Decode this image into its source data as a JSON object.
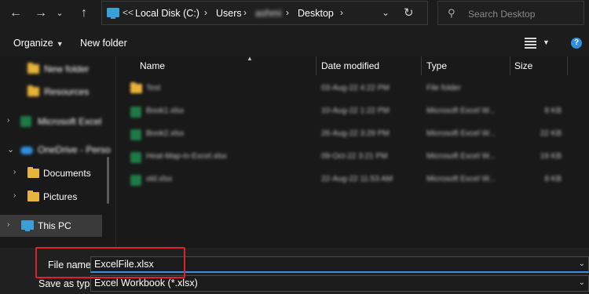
{
  "nav": {
    "back_icon": "arrow-left-icon",
    "forward_icon": "arrow-right-icon",
    "recent_icon": "chevron-down-icon",
    "up_icon": "arrow-up-icon"
  },
  "address": {
    "overflow": "<<",
    "crumbs": [
      "Local Disk (C:)",
      "Users",
      "ashmi",
      "Desktop"
    ]
  },
  "search": {
    "placeholder": "Search Desktop"
  },
  "toolbar": {
    "organize": "Organize",
    "new_folder": "New folder"
  },
  "sidebar": {
    "items": [
      {
        "label": "New folder",
        "icon": "folder-icon"
      },
      {
        "label": "Resources",
        "icon": "folder-icon"
      },
      {
        "label": "Microsoft Excel",
        "icon": "excel-icon"
      },
      {
        "label": "OneDrive - Perso",
        "icon": "onedrive-icon"
      },
      {
        "label": "Documents",
        "icon": "folder-icon"
      },
      {
        "label": "Pictures",
        "icon": "folder-icon"
      },
      {
        "label": "This PC",
        "icon": "pc-icon"
      }
    ]
  },
  "columns": {
    "name": "Name",
    "date": "Date modified",
    "type": "Type",
    "size": "Size"
  },
  "files": [
    {
      "name": "Test",
      "date": "03-Aug-22 4:22 PM",
      "type": "File folder",
      "size": "",
      "icon": "folder-icon"
    },
    {
      "name": "Book1.xlsx",
      "date": "10-Aug-22 1:22 PM",
      "type": "Microsoft Excel W...",
      "size": "8 KB",
      "icon": "excel-icon"
    },
    {
      "name": "Book2.xlsx",
      "date": "26-Aug-22 3:29 PM",
      "type": "Microsoft Excel W...",
      "size": "22 KB",
      "icon": "excel-icon"
    },
    {
      "name": "Heat-Map-in-Excel.xlsx",
      "date": "09-Oct-22 3:21 PM",
      "type": "Microsoft Excel W...",
      "size": "19 KB",
      "icon": "excel-icon"
    },
    {
      "name": "old.xlsx",
      "date": "22-Aug-22 11:53 AM",
      "type": "Microsoft Excel W...",
      "size": "8 KB",
      "icon": "excel-icon"
    }
  ],
  "save": {
    "file_name_label": "File name:",
    "file_name_value": "ExcelFile.xlsx",
    "save_type_label": "Save as type:",
    "save_type_value": "Excel Workbook (*.xlsx)"
  },
  "colors": {
    "background": "#191919",
    "accent": "#3f8fdc",
    "highlight": "#d9232d"
  }
}
